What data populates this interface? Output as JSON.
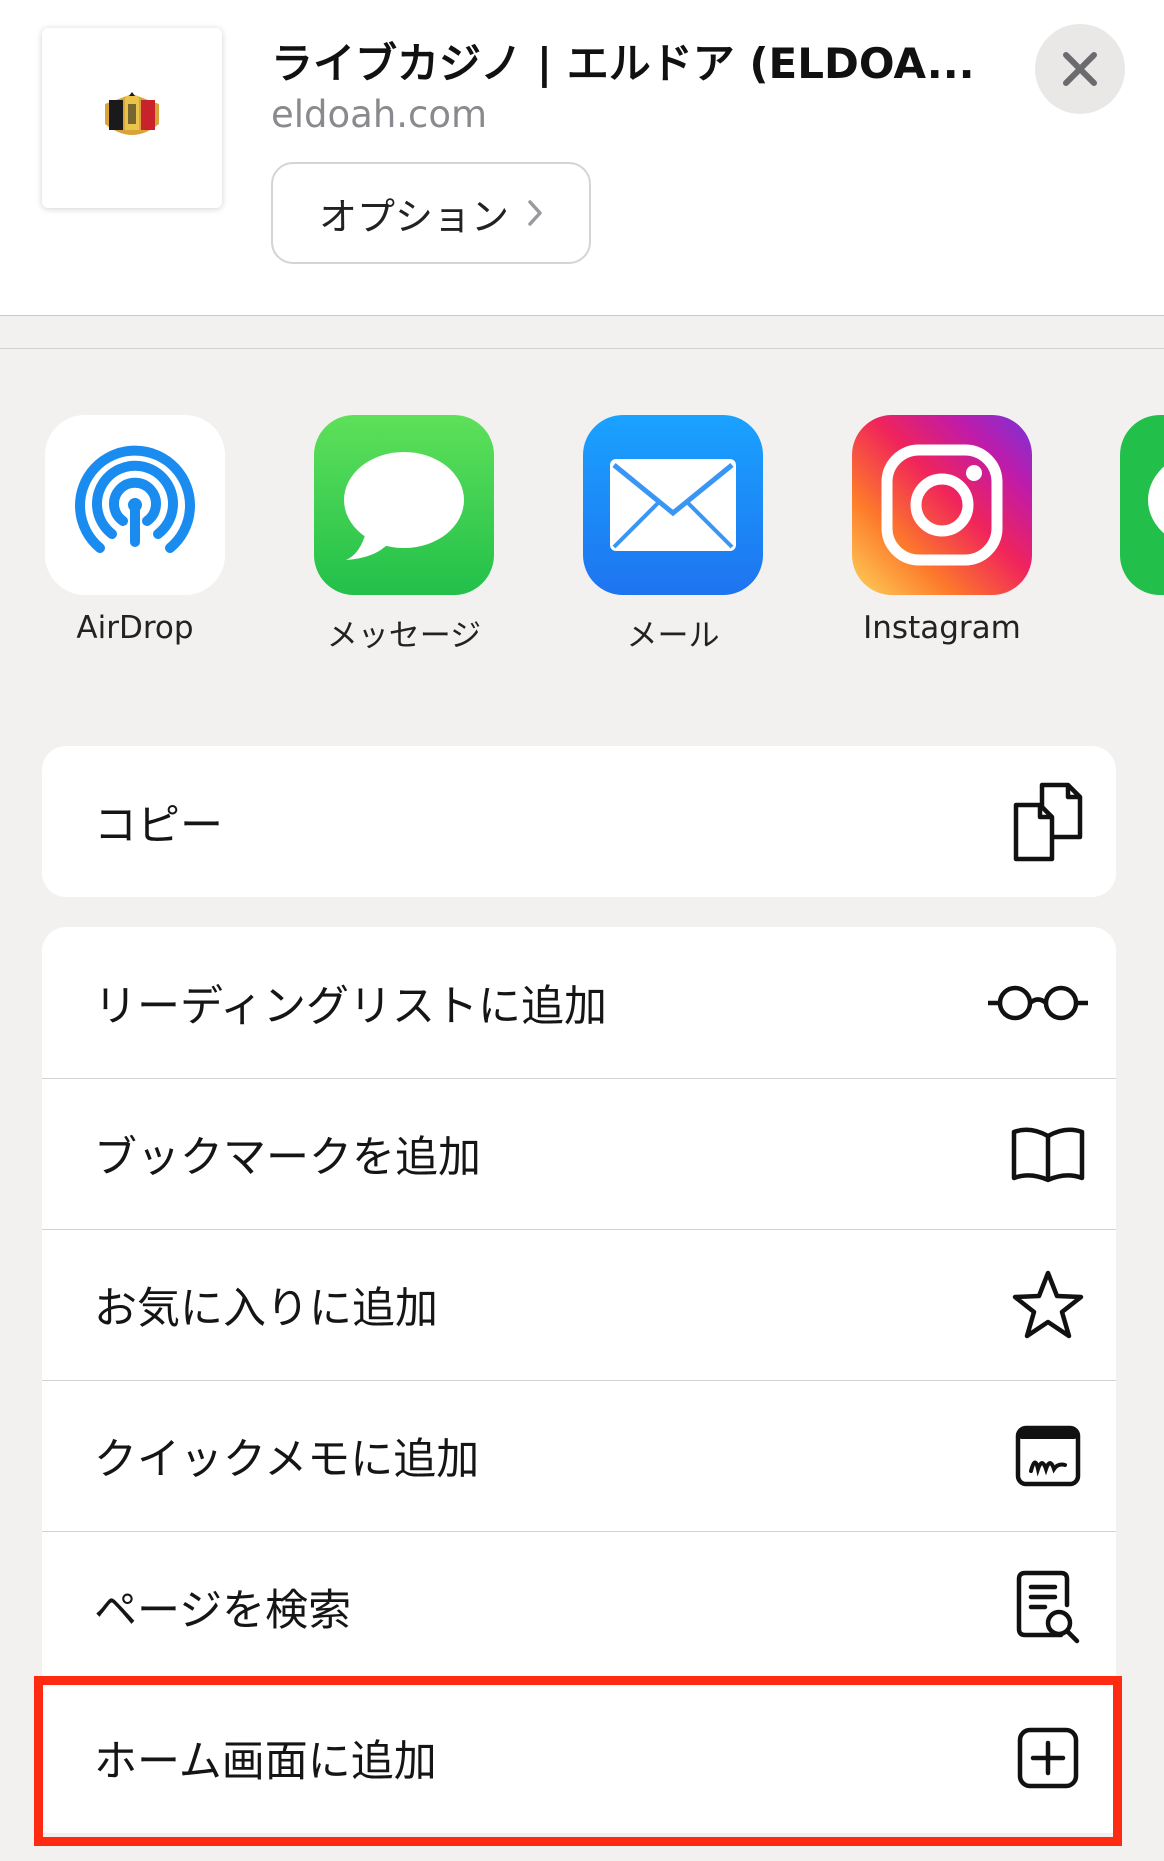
{
  "header": {
    "site_title": "ライブカジノ | エルドア (ELDOA...",
    "site_url": "eldoah.com",
    "options_label": "オプション",
    "close_icon": "close-icon",
    "chevron_icon": "chevron-right-icon"
  },
  "apps": [
    {
      "label": "AirDrop",
      "icon": "airdrop-icon"
    },
    {
      "label": "メッセージ",
      "icon": "messages-icon"
    },
    {
      "label": "メール",
      "icon": "mail-icon"
    },
    {
      "label": "Instagram",
      "icon": "instagram-icon"
    },
    {
      "label": "",
      "icon": "line-app-icon"
    }
  ],
  "actions": {
    "copy": {
      "label": "コピー",
      "icon": "copy-icon"
    },
    "reading_list": {
      "label": "リーディングリストに追加",
      "icon": "glasses-icon"
    },
    "bookmark": {
      "label": "ブックマークを追加",
      "icon": "book-icon"
    },
    "favorites": {
      "label": "お気に入りに追加",
      "icon": "star-icon"
    },
    "quick_note": {
      "label": "クイックメモに追加",
      "icon": "quick-note-icon"
    },
    "find_on_page": {
      "label": "ページを検索",
      "icon": "find-page-icon"
    },
    "add_to_home": {
      "label": "ホーム画面に追加",
      "icon": "add-square-icon"
    }
  },
  "colors": {
    "highlight": "#ff2a12",
    "messages_green": "#34c759",
    "mail_blue": "#1e8ff6",
    "airdrop_blue": "#1a8cf0",
    "sheet_background": "#f2f1f0"
  }
}
